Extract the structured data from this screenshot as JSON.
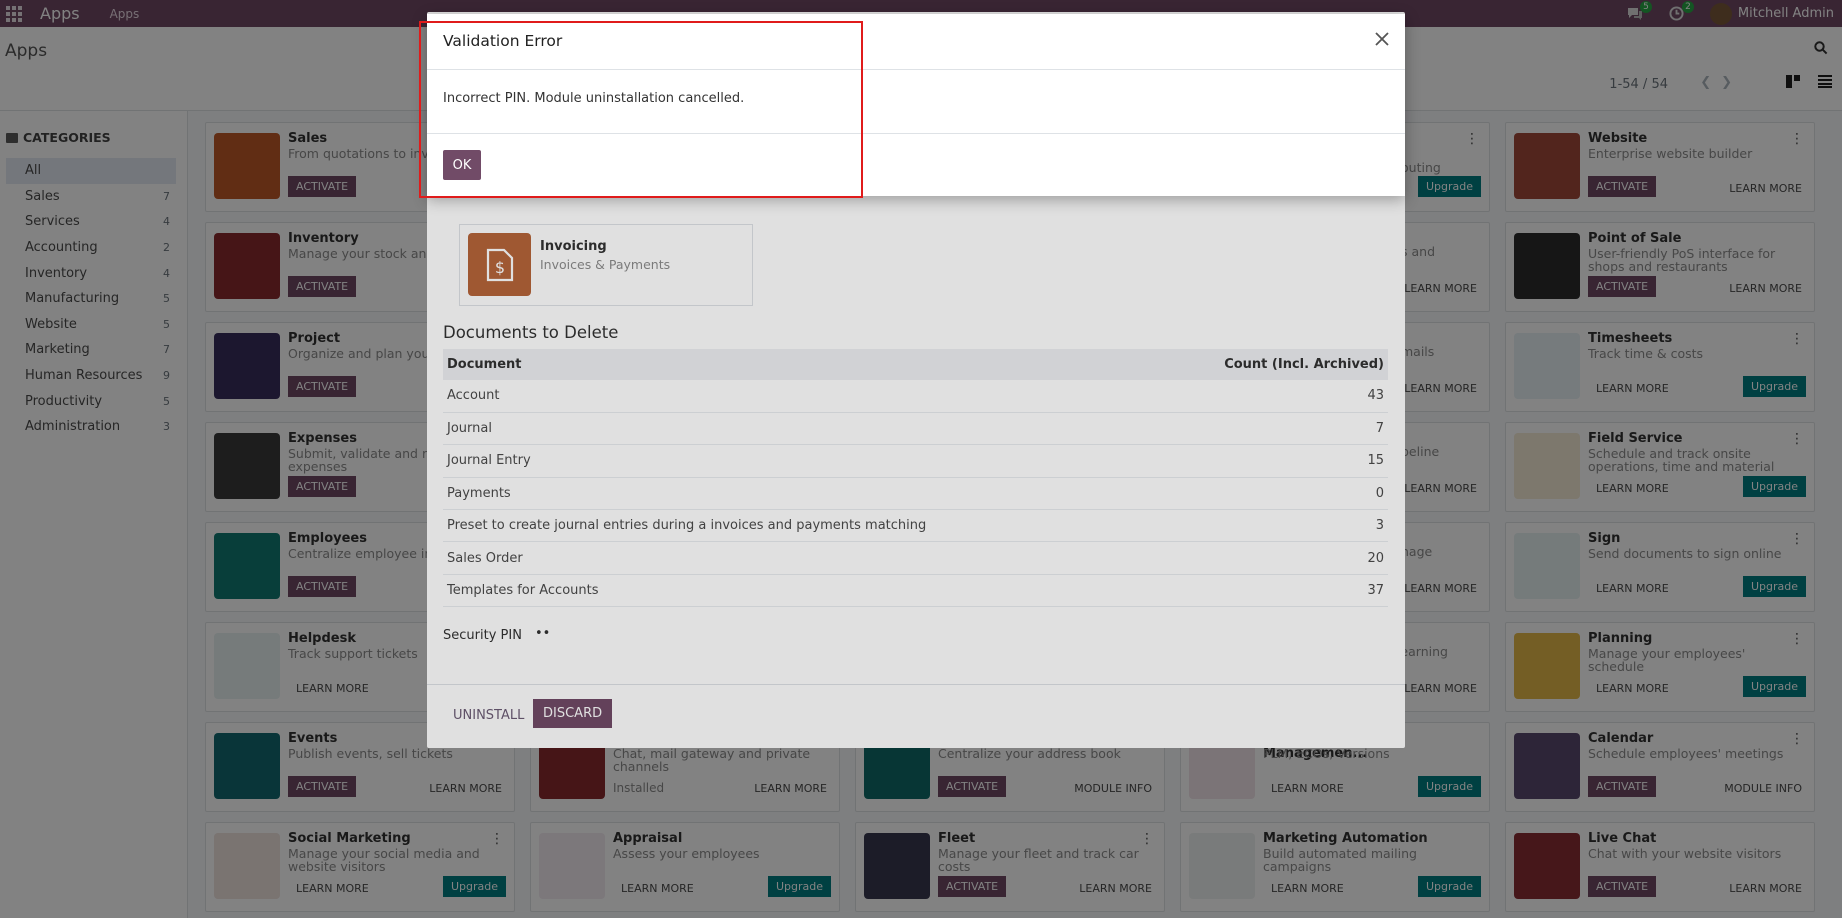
{
  "navbar": {
    "brand": "Apps",
    "menu": "Apps",
    "messages_badge": "5",
    "activities_badge": "2",
    "user": "Mitchell Admin"
  },
  "control": {
    "breadcrumb": "Apps",
    "pager": "1-54 / 54"
  },
  "sidebar": {
    "title": "CATEGORIES",
    "items": [
      {
        "label": "All",
        "count": ""
      },
      {
        "label": "Sales",
        "count": "7"
      },
      {
        "label": "Services",
        "count": "4"
      },
      {
        "label": "Accounting",
        "count": "2"
      },
      {
        "label": "Inventory",
        "count": "4"
      },
      {
        "label": "Manufacturing",
        "count": "5"
      },
      {
        "label": "Website",
        "count": "5"
      },
      {
        "label": "Marketing",
        "count": "7"
      },
      {
        "label": "Human Resources",
        "count": "9"
      },
      {
        "label": "Productivity",
        "count": "5"
      },
      {
        "label": "Administration",
        "count": "3"
      }
    ]
  },
  "cards_left": [
    {
      "name": "Sales",
      "summary": "From quotations to inv",
      "button": "ACTIVATE",
      "color": "#c05a28"
    },
    {
      "name": "Inventory",
      "summary": "Manage your stock and activities",
      "button": "ACTIVATE",
      "color": "#8b2a2f"
    },
    {
      "name": "Project",
      "summary": "Organize and plan your",
      "button": "ACTIVATE",
      "color": "#38305e"
    },
    {
      "name": "Expenses",
      "summary": "Submit, validate and re employee expenses",
      "button": "ACTIVATE",
      "color": "#3a3a3a"
    },
    {
      "name": "Employees",
      "summary": "Centralize employee inf",
      "button": "ACTIVATE",
      "color": "#127a73"
    },
    {
      "name": "Helpdesk",
      "summary": "Track support tickets",
      "learn": "LEARN MORE",
      "color": "#e8f3f3"
    },
    {
      "name": "Events",
      "summary": "Publish events, sell tickets",
      "button": "ACTIVATE",
      "learn": "LEARN MORE",
      "color": "#136a70"
    },
    {
      "name": "Social Marketing",
      "summary": "Manage your social media and website visitors",
      "learn": "LEARN MORE",
      "upgrade": "Upgrade",
      "color": "#f0e3df"
    }
  ],
  "cards_right": [
    {
      "name": "Website",
      "summary": "Enterprise website builder",
      "button": "ACTIVATE",
      "learn": "LEARN MORE",
      "color": "#a34a3a"
    },
    {
      "name": "Point of Sale",
      "summary": "User-friendly PoS interface for shops and restaurants",
      "button": "ACTIVATE",
      "learn": "LEARN MORE",
      "color": "#2e2e2e"
    },
    {
      "name": "Timesheets",
      "summary": "Track time & costs",
      "learn": "LEARN MORE",
      "upgrade": "Upgrade",
      "color": "#e8f1f6"
    },
    {
      "name": "Field Service",
      "summary": "Schedule and track onsite operations, time and material",
      "learn": "LEARN MORE",
      "upgrade": "Upgrade",
      "color": "#f6ecd8"
    },
    {
      "name": "Sign",
      "summary": "Send documents to sign online",
      "learn": "LEARN MORE",
      "upgrade": "Upgrade",
      "color": "#e7f2f3"
    },
    {
      "name": "Planning",
      "summary": "Manage your employees' schedule",
      "learn": "LEARN MORE",
      "upgrade": "Upgrade",
      "color": "#e6b84a"
    },
    {
      "name": "Calendar",
      "summary": "Schedule employees' meetings",
      "button": "ACTIVATE",
      "learn": "MODULE INFO",
      "color": "#5b4a6e"
    },
    {
      "name": "Live Chat",
      "summary": "Chat with your website visitors",
      "button": "ACTIVATE",
      "learn": "LEARN MORE",
      "color": "#8a2f35"
    }
  ],
  "cards_row7": [
    {
      "summary": "Chat, mail gateway and private channels",
      "status": "Installed",
      "learn": "LEARN MORE",
      "color": "#8b2a2f"
    },
    {
      "summary": "Centralize your address book",
      "button": "ACTIVATE",
      "learn": "MODULE INFO",
      "color": "#0f6c6a"
    },
    {
      "name": "Product Lifecycle Managemen...",
      "summary": "PLM, ECOs, Versions",
      "learn": "LEARN MORE",
      "upgrade": "Upgrade",
      "color": "#f2e4ea"
    }
  ],
  "cards_row8": [
    {
      "name": "Appraisal",
      "summary": "Assess your employees",
      "learn": "LEARN MORE",
      "upgrade": "Upgrade",
      "color": "#f5ecf3"
    },
    {
      "name": "Fleet",
      "summary": "Manage your fleet and track car costs",
      "button": "ACTIVATE",
      "learn": "LEARN MORE",
      "color": "#383850"
    },
    {
      "name": "Marketing Automation",
      "summary": "Build automated mailing campaigns",
      "learn": "LEARN MORE",
      "upgrade": "Upgrade",
      "color": "#eef3f2"
    }
  ],
  "peek_texts": [
    "outing",
    "s and",
    "mails",
    "peline",
    "nage",
    "eLearning"
  ],
  "peek_learn": "LEARN MORE",
  "peek_upgrade": "Upgrade",
  "uninstall": {
    "app_name": "Invoicing",
    "app_summary": "Invoices & Payments",
    "docs_title": "Documents to Delete",
    "col_document": "Document",
    "col_count": "Count (Incl. Archived)",
    "rows": [
      {
        "doc": "Account",
        "count": "43"
      },
      {
        "doc": "Journal",
        "count": "7"
      },
      {
        "doc": "Journal Entry",
        "count": "15"
      },
      {
        "doc": "Payments",
        "count": "0"
      },
      {
        "doc": "Preset to create journal entries during a invoices and payments matching",
        "count": "3"
      },
      {
        "doc": "Sales Order",
        "count": "20"
      },
      {
        "doc": "Templates for Accounts",
        "count": "37"
      }
    ],
    "pin_label": "Security PIN",
    "pin_value": "••",
    "btn_uninstall": "UNINSTALL",
    "btn_discard": "DISCARD"
  },
  "validation": {
    "title": "Validation Error",
    "message": "Incorrect PIN. Module uninstallation cancelled.",
    "ok": "OK"
  }
}
